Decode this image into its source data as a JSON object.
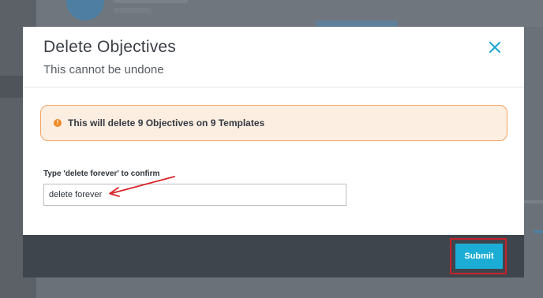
{
  "dialog": {
    "title": "Delete Objectives",
    "subtitle": "This cannot be undone",
    "close_icon": "close-icon"
  },
  "warning": {
    "icon": "alert-circle-icon",
    "icon_glyph": "!",
    "text": "This will delete 9 Objectives on 9 Templates",
    "color": "#f08a25"
  },
  "confirm": {
    "label": "Type 'delete forever' to confirm",
    "value": "delete forever"
  },
  "footer": {
    "submit_label": "Submit",
    "submit_color": "#1cadd6"
  },
  "annotations": {
    "arrow_color": "#d9252b",
    "highlight_color": "#c62229"
  }
}
